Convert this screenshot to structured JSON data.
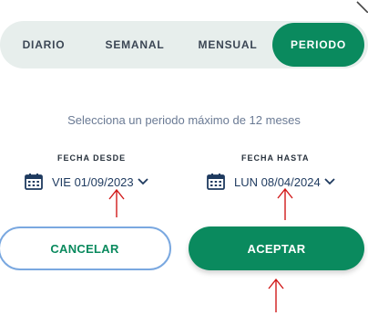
{
  "tabs": [
    {
      "label": "DIARIO",
      "active": false
    },
    {
      "label": "SEMANAL",
      "active": false
    },
    {
      "label": "MENSUAL",
      "active": false
    },
    {
      "label": "PERIODO",
      "active": true
    }
  ],
  "hint": "Selecciona un periodo máximo de 12 meses",
  "from": {
    "label": "FECHA DESDE",
    "value": "VIE 01/09/2023",
    "icon": "calendar-icon"
  },
  "to": {
    "label": "FECHA HASTA",
    "value": "LUN 08/04/2024",
    "icon": "calendar-icon"
  },
  "buttons": {
    "cancel": "CANCELAR",
    "accept": "ACEPTAR"
  },
  "colors": {
    "accent": "#0a8a5e",
    "cancel_border": "#7aa8e0",
    "annotation": "#d11a1a"
  }
}
